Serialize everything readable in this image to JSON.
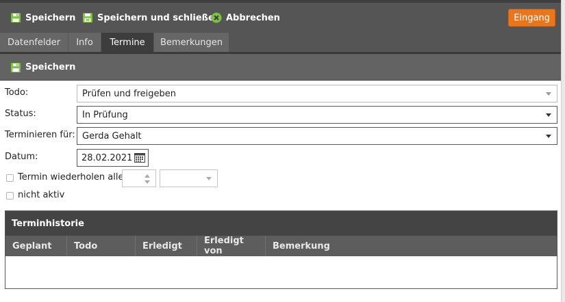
{
  "toolbar": {
    "save_label": "Speichern",
    "save_close_label": "Speichern und schließen",
    "cancel_label": "Abbrechen",
    "inbox_label": "Eingang"
  },
  "tabs": [
    {
      "label": "Datenfelder"
    },
    {
      "label": "Info"
    },
    {
      "label": "Termine"
    },
    {
      "label": "Bemerkungen"
    }
  ],
  "subtoolbar": {
    "save_label": "Speichern"
  },
  "form": {
    "todo_label": "Todo:",
    "todo_value": "Prüfen und freigeben",
    "status_label": "Status:",
    "status_value": "In Prüfung",
    "assign_label": "Terminieren für:",
    "assign_value": "Gerda Gehalt",
    "date_label": "Datum:",
    "date_value": "28.02.2021",
    "repeat_label": "Termin wiederholen alle",
    "inactive_label": "nicht aktiv"
  },
  "history": {
    "title": "Terminhistorie",
    "columns": [
      "Geplant",
      "Todo",
      "Erledigt",
      "Erledigt von",
      "Bemerkung"
    ]
  },
  "colors": {
    "toolbar_bg": "#555555",
    "active_tab": "#3d3d3d",
    "accent_green": "#7dc242",
    "inbox_orange": "#e8761e"
  }
}
